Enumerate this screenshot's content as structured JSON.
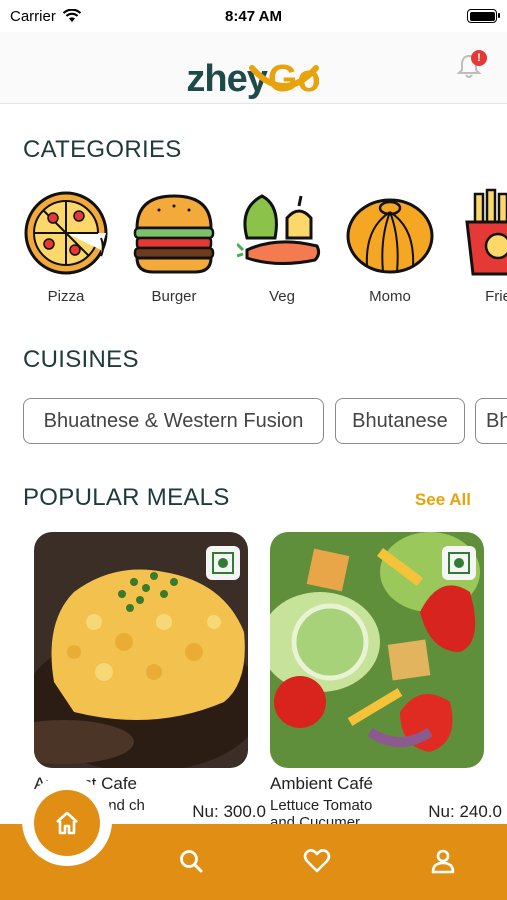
{
  "status_bar": {
    "carrier": "Carrier",
    "time": "8:47 AM"
  },
  "header": {
    "logo_text": "zhey",
    "logo_accent": "Go",
    "notification_badge": "!"
  },
  "categories": {
    "title": "CATEGORIES",
    "items": [
      {
        "label": "Pizza",
        "icon": "pizza-icon"
      },
      {
        "label": "Burger",
        "icon": "burger-icon"
      },
      {
        "label": "Veg",
        "icon": "veg-icon"
      },
      {
        "label": "Momo",
        "icon": "momo-icon"
      },
      {
        "label": "Frie",
        "icon": "fries-icon"
      }
    ]
  },
  "cuisines": {
    "title": "CUISINES",
    "items": [
      "Bhuatnese & Western Fusion",
      "Bhutanese",
      "Bh"
    ]
  },
  "popular_meals": {
    "title": "POPULAR MEALS",
    "see_all": "See All",
    "items": [
      {
        "cafe": "App test Cafe",
        "name": "Macaroni and ch",
        "price": "Nu: 300.0"
      },
      {
        "cafe": "Ambient Café",
        "name": "Lettuce Tomato and Cucumer",
        "price": "Nu: 240.0"
      }
    ]
  },
  "colors": {
    "accent": "#e08f14",
    "brand_dark": "#1e4a4a",
    "brand_yellow": "#e8a20c"
  }
}
